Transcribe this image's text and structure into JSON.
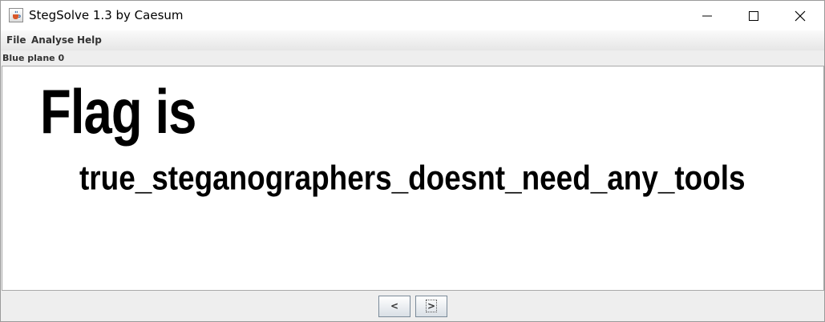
{
  "window": {
    "title": "StegSolve 1.3 by Caesum"
  },
  "menu": {
    "file": "File",
    "analyse": "Analyse",
    "help": "Help"
  },
  "viewer": {
    "plane_label": "Blue plane 0",
    "heading_text": "Flag is",
    "flag_text": "true_steganographers_doesnt_need_any_tools"
  },
  "navigation": {
    "prev_label": "<",
    "next_label": ">"
  },
  "icons": {
    "app": "java-coffee-cup-icon",
    "minimize": "minimize-icon",
    "maximize": "maximize-icon",
    "close": "close-icon"
  },
  "colors": {
    "panel_background": "#ffffff",
    "window_background": "#eeeeee",
    "text": "#000000"
  }
}
